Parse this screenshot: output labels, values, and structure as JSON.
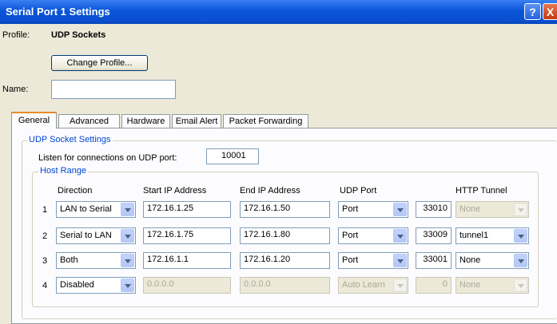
{
  "window": {
    "title": "Serial Port 1 Settings",
    "help": "?",
    "close": "X"
  },
  "profile": {
    "label": "Profile:",
    "value": "UDP Sockets",
    "change_button": "Change Profile..."
  },
  "name": {
    "label": "Name:",
    "value": ""
  },
  "tabs": [
    "General",
    "Advanced",
    "Hardware",
    "Email Alert",
    "Packet Forwarding"
  ],
  "udp_settings": {
    "legend": "UDP Socket Settings",
    "listen_label": "Listen for connections on UDP port:",
    "listen_port": "10001"
  },
  "host_range": {
    "legend": "Host Range",
    "headers": {
      "direction": "Direction",
      "start_ip": "Start IP Address",
      "end_ip": "End IP Address",
      "udp_port": "UDP Port",
      "http_tunnel": "HTTP Tunnel"
    },
    "rows": [
      {
        "num": "1",
        "direction": "LAN to Serial",
        "start_ip": "172.16.1.25",
        "end_ip": "172.16.1.50",
        "port_mode": "Port",
        "port": "33010",
        "tunnel": "None",
        "enabled": true,
        "tunnel_enabled": false
      },
      {
        "num": "2",
        "direction": "Serial to LAN",
        "start_ip": "172.16.1.75",
        "end_ip": "172.16.1.80",
        "port_mode": "Port",
        "port": "33009",
        "tunnel": "tunnel1",
        "enabled": true,
        "tunnel_enabled": true
      },
      {
        "num": "3",
        "direction": "Both",
        "start_ip": "172.16.1.1",
        "end_ip": "172.16.1.20",
        "port_mode": "Port",
        "port": "33001",
        "tunnel": "None",
        "enabled": true,
        "tunnel_enabled": true
      },
      {
        "num": "4",
        "direction": "Disabled",
        "start_ip": "0.0.0.0",
        "end_ip": "0.0.0.0",
        "port_mode": "Auto Learn",
        "port": "0",
        "tunnel": "None",
        "enabled": false,
        "tunnel_enabled": false
      }
    ]
  }
}
